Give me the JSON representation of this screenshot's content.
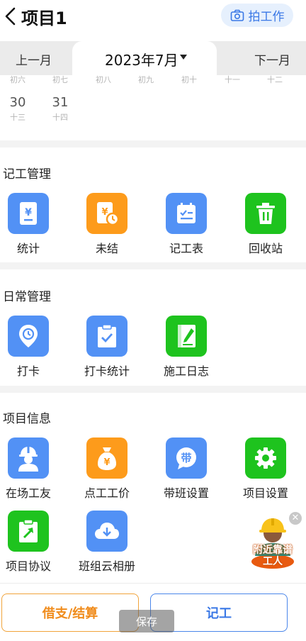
{
  "header": {
    "title": "项目1",
    "photo_button": "拍工作"
  },
  "month_bar": {
    "prev": "上一月",
    "current": "2023年7月",
    "next": "下一月"
  },
  "calendar": {
    "lunar_row": [
      "初六",
      "初七",
      "初八",
      "初九",
      "初十",
      "十一",
      "十二"
    ],
    "days": [
      {
        "day": "30",
        "lunar": "十三"
      },
      {
        "day": "31",
        "lunar": "十四"
      }
    ]
  },
  "record_mgmt": {
    "title": "记工管理",
    "items": [
      {
        "label": "统计",
        "icon": "statistics-icon",
        "color": "#5291f5"
      },
      {
        "label": "未结",
        "icon": "unsettled-icon",
        "color": "#fd9b1b"
      },
      {
        "label": "记工表",
        "icon": "record-sheet-icon",
        "color": "#5291f5"
      },
      {
        "label": "回收站",
        "icon": "trash-icon",
        "color": "#1ec31e"
      }
    ]
  },
  "daily_mgmt": {
    "title": "日常管理",
    "items": [
      {
        "label": "打卡",
        "icon": "clock-in-icon",
        "color": "#5291f5"
      },
      {
        "label": "打卡统计",
        "icon": "checkin-stats-icon",
        "color": "#5291f5"
      },
      {
        "label": "施工日志",
        "icon": "construction-log-icon",
        "color": "#1ec31e"
      }
    ]
  },
  "project_info": {
    "title": "项目信息",
    "items": [
      {
        "label": "在场工友",
        "icon": "worker-icon",
        "color": "#5291f5"
      },
      {
        "label": "点工工价",
        "icon": "money-bag-icon",
        "color": "#fd9b1b"
      },
      {
        "label": "带班设置",
        "icon": "team-lead-icon",
        "color": "#5291f5"
      },
      {
        "label": "项目设置",
        "icon": "gear-icon",
        "color": "#1ec31e"
      },
      {
        "label": "项目协议",
        "icon": "agreement-icon",
        "color": "#1ec31e"
      },
      {
        "label": "班组云相册",
        "icon": "cloud-album-icon",
        "color": "#5291f5"
      }
    ]
  },
  "bottom": {
    "loan_button": "借支/结算",
    "record_button": "记工",
    "toast": "保存"
  },
  "ad": {
    "text": "附近靠谱工人"
  }
}
